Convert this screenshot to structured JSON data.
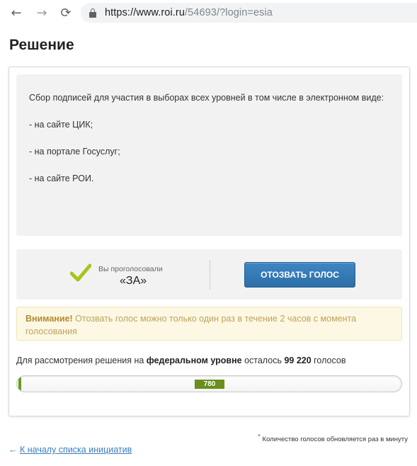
{
  "browser": {
    "url_host": "https://www.roi.ru",
    "url_path": "/54693/?login=esia",
    "back_icon": "←",
    "forward_icon": "→",
    "reload_icon": "⟳"
  },
  "page": {
    "title": "Решение"
  },
  "description": {
    "lines": [
      "Сбор подписей для участия в выборах всех уровней в том числе в электронном виде:",
      "- на сайте ЦИК;",
      "- на портале Госуслуг;",
      "- на сайте РОИ."
    ]
  },
  "vote": {
    "status_label": "Вы проголосовали",
    "status_value": "«ЗА»",
    "revoke_button": "Отозвать голос",
    "check_color": "#a6c51e"
  },
  "warning": {
    "title": "Внимание!",
    "text": "Отозвать голос можно только один раз в течение 2 часов с момента голосования"
  },
  "progress": {
    "text_before": "Для рассмотрения решения на ",
    "level": "федеральном уровне",
    "text_middle": " осталось ",
    "remaining": "99 220",
    "text_after": " голосов",
    "votes": "780",
    "votes_fraction": 0.0078
  },
  "footnote": {
    "mark": "*",
    "text": "Количество голосов обновляется раз в минуту"
  },
  "back_link": {
    "arrow": "←",
    "text": "К началу списка инициатив"
  }
}
